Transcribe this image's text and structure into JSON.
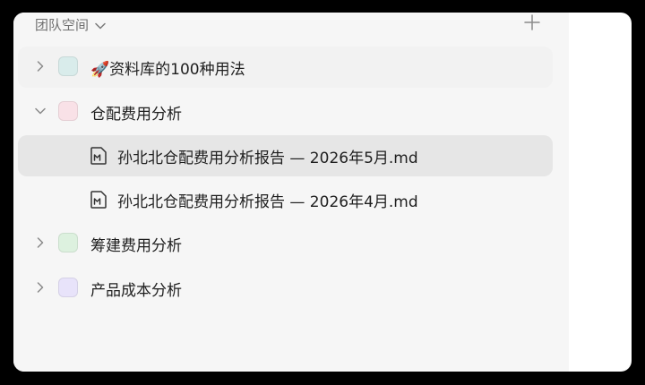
{
  "header": {
    "title": "团队空间"
  },
  "tree": [
    {
      "label": "🚀资料库的100种用法",
      "color": "#d9eceb"
    },
    {
      "label": "仓配费用分析",
      "color": "#f9e1e7"
    },
    {
      "label": "孙北北仓配费用分析报告 — 2026年5月.md"
    },
    {
      "label": "孙北北仓配费用分析报告 — 2026年4月.md"
    },
    {
      "label": "筹建费用分析",
      "color": "#ddf1df"
    },
    {
      "label": "产品成本分析",
      "color": "#e8e3fa"
    }
  ],
  "icons": {
    "collapsed": "chevron-right-icon",
    "expanded": "chevron-down-icon",
    "markdown_file": "markdown-file-icon",
    "add": "plus-icon"
  }
}
